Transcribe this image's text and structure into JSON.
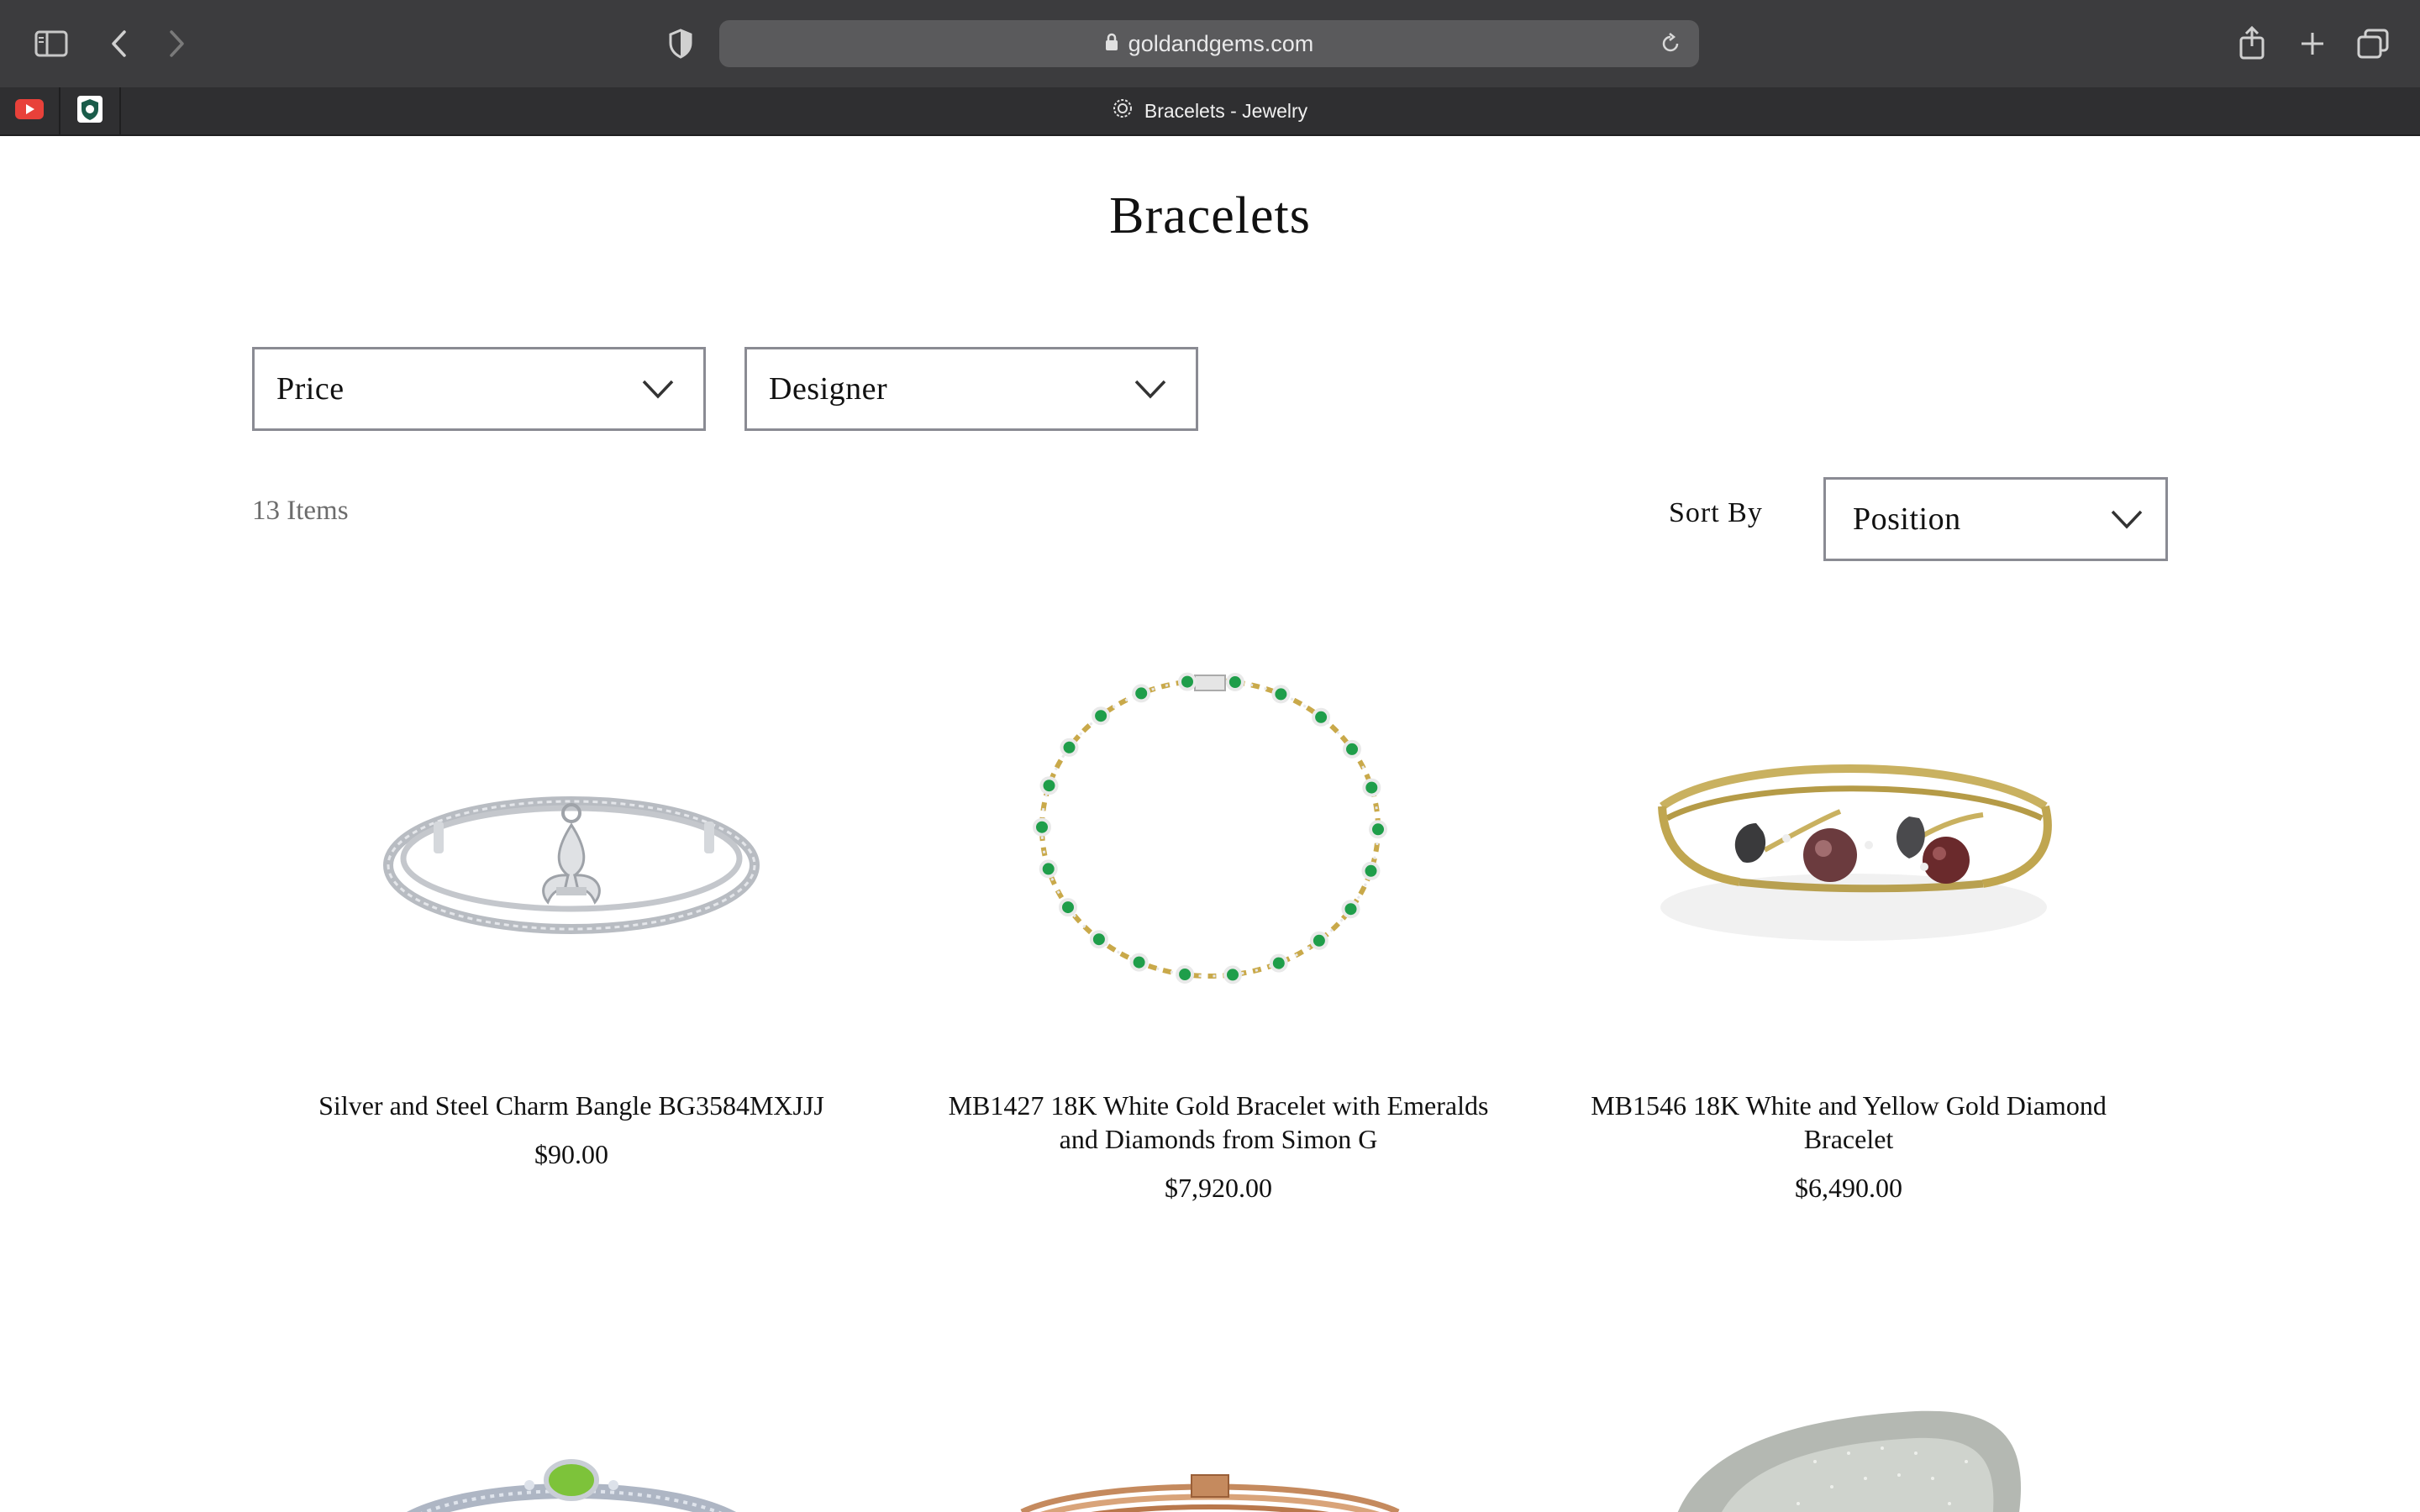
{
  "browser": {
    "url": "goldandgems.com",
    "tab_title": "Bracelets - Jewelry",
    "pinned_tabs": [
      "youtube-icon",
      "shield-crest-icon"
    ]
  },
  "page": {
    "title": "Bracelets",
    "filters": {
      "price_label": "Price",
      "designer_label": "Designer"
    },
    "items_count": "13 Items",
    "sort": {
      "label": "Sort By",
      "selected": "Position"
    }
  },
  "products": [
    {
      "name_line1": "Silver and Steel Charm Bangle BG3584MXJJJ",
      "name_line2": "",
      "price": "$90.00"
    },
    {
      "name_line1": "MB1427 18K White Gold Bracelet with Emeralds",
      "name_line2": "and Diamonds from Simon G",
      "price": "$7,920.00"
    },
    {
      "name_line1": "MB1546 18K White and Yellow Gold Diamond",
      "name_line2": "Bracelet",
      "price": "$6,490.00"
    }
  ],
  "colors": {
    "toolbar": "#3c3c3e",
    "tabbar": "#2f2f31",
    "dropdown_border": "#8a8b93",
    "emerald": "#1f9e4a",
    "gold": "#c9a94a",
    "silver": "#b8bcc2"
  }
}
